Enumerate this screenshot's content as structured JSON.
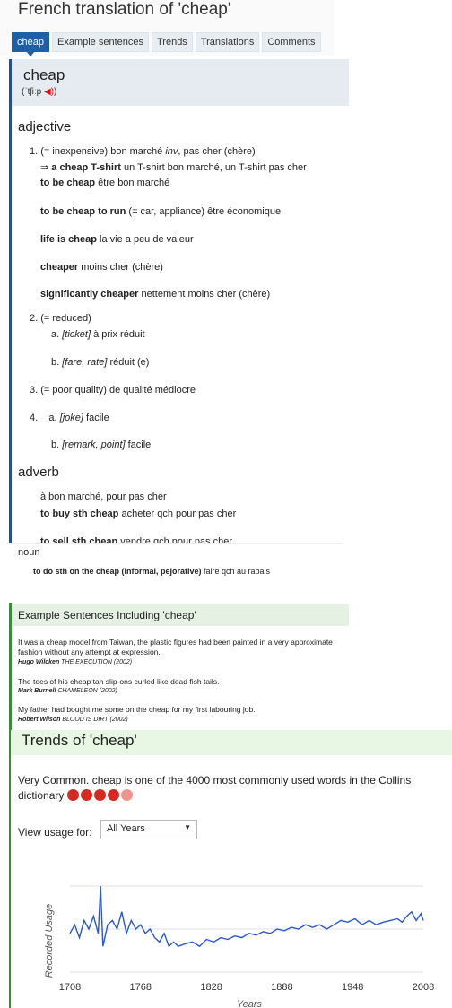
{
  "page": {
    "title": "French translation of 'cheap'"
  },
  "tabs": [
    "cheap",
    "Example sentences",
    "Trends",
    "Translations",
    "Comments"
  ],
  "entry": {
    "headword": "cheap",
    "pronunciation": "(ˈtʃiːp ",
    "pronunciation_end": ")",
    "adjective_label": "adjective",
    "sense1_num": "1.",
    "sense1_gloss": "(= inexpensive) bon marché ",
    "sense1_inv": "inv",
    "sense1_rest": ", pas cher (chère)",
    "ex1_arrow": "⇒ ",
    "ex1_en": "a cheap T-shirt",
    "ex1_fr": " un T-shirt bon marché, un T-shirt pas cher",
    "ex2_en": "to be cheap",
    "ex2_fr": " être bon marché",
    "ex3_en": "to be cheap to run",
    "ex3_fr": " (= car, appliance) être économique",
    "ex4_en": "life is cheap",
    "ex4_fr": " la vie a peu de valeur",
    "ex5_en": "cheaper",
    "ex5_fr": " moins cher (chère)",
    "ex6_en": "significantly cheaper",
    "ex6_fr": " nettement moins cher (chère)",
    "sense2_num": "2.",
    "sense2_gloss": "(= reduced)",
    "sense2a_label": "a.",
    "sense2a_ctx": "[ticket]",
    "sense2a_fr": " à prix réduit",
    "sense2b_label": "b.",
    "sense2b_ctx": "[fare, rate]",
    "sense2b_fr": " réduit (e)",
    "sense3_num": "3.",
    "sense3_gloss": "(= poor quality) de qualité médiocre",
    "sense4_num": "4.",
    "sense4a_label": "a.",
    "sense4a_ctx": "[joke]",
    "sense4a_fr": " facile",
    "sense4b_label": "b.",
    "sense4b_ctx": "[remark, point]",
    "sense4b_fr": " facile",
    "adverb_label": "adverb",
    "adv1": "à bon marché, pour pas cher",
    "adv2_en": "to buy sth cheap",
    "adv2_fr": " acheter qch pour pas cher",
    "adv3_en": "to sell sth cheap",
    "adv3_fr": " vendre qch pour pas cher",
    "noun_label": "noun",
    "noun1_en": "to do sth on the cheap (informal, pejorative)",
    "noun1_fr": " faire qch au rabais"
  },
  "examples": {
    "title": "Example Sentences Including 'cheap'",
    "items": [
      {
        "text": "It was a cheap model from Taiwan, the plastic figures had been painted in a very approximate fashion without any attempt at expression.",
        "author": "Hugo Wilcken",
        "work": " THE EXECUTION (2002)"
      },
      {
        "text": "The toes of his cheap tan slip-ons curled like dead fish tails.",
        "author": "Mark Burnell",
        "work": " CHAMELEON (2002)"
      },
      {
        "text": "My father had bought me some on the cheap for my first labouring job.",
        "author": "Robert Wilson",
        "work": " BLOOD IS DIRT (2002)"
      }
    ]
  },
  "trends": {
    "title": "Trends of 'cheap'",
    "description": "Very Common. cheap is one of the 4000 most commonly used words in the Collins dictionary",
    "frequency_dots": 5,
    "frequency_filled": 4,
    "colors": {
      "dot_filled": "#d42a22",
      "dot_empty": "#f0958d"
    },
    "view_label": "View usage for:",
    "select_value": "All Years",
    "select_arrow": "▼"
  },
  "chart_data": {
    "type": "line",
    "ylabel": "Recorded Usage",
    "xlabel": "Years",
    "tick_labels": [
      "1708",
      "1768",
      "1828",
      "1888",
      "1948",
      "2008"
    ],
    "xlim": [
      1708,
      2008
    ],
    "color": "#2b57c8",
    "grid": true,
    "x": [
      1708,
      1712,
      1716,
      1720,
      1724,
      1728,
      1732,
      1734,
      1736,
      1740,
      1744,
      1748,
      1752,
      1756,
      1760,
      1764,
      1768,
      1772,
      1776,
      1780,
      1784,
      1788,
      1792,
      1796,
      1800,
      1806,
      1812,
      1818,
      1824,
      1830,
      1836,
      1842,
      1848,
      1854,
      1860,
      1866,
      1872,
      1878,
      1884,
      1890,
      1896,
      1902,
      1908,
      1914,
      1920,
      1926,
      1932,
      1938,
      1944,
      1950,
      1956,
      1962,
      1968,
      1974,
      1980,
      1986,
      1990,
      1994,
      1998,
      2002,
      2006,
      2008
    ],
    "values": [
      0.45,
      0.55,
      0.4,
      0.6,
      0.5,
      0.65,
      0.45,
      1.0,
      0.3,
      0.55,
      0.6,
      0.5,
      0.7,
      0.45,
      0.6,
      0.5,
      0.55,
      0.45,
      0.5,
      0.4,
      0.35,
      0.45,
      0.3,
      0.35,
      0.3,
      0.33,
      0.35,
      0.3,
      0.38,
      0.35,
      0.4,
      0.38,
      0.42,
      0.4,
      0.45,
      0.43,
      0.47,
      0.45,
      0.5,
      0.48,
      0.52,
      0.5,
      0.55,
      0.52,
      0.55,
      0.5,
      0.55,
      0.6,
      0.58,
      0.62,
      0.55,
      0.6,
      0.55,
      0.58,
      0.6,
      0.62,
      0.58,
      0.65,
      0.7,
      0.6,
      0.68,
      0.6
    ]
  }
}
